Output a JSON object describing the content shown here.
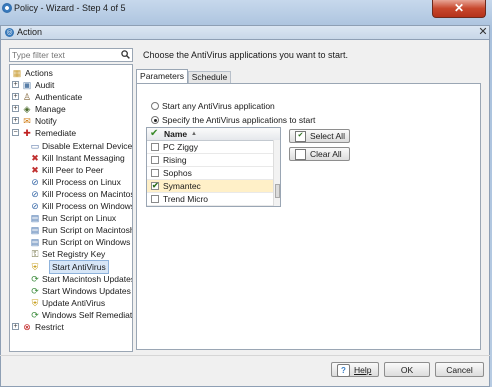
{
  "window": {
    "title": "Policy - Wizard - Step 4 of 5",
    "close_glyph": "✕"
  },
  "dialog": {
    "title": "Action",
    "close_glyph": "✕"
  },
  "filter": {
    "placeholder": "Type filter text"
  },
  "tree": {
    "root": "Actions",
    "items": [
      {
        "label": "Audit",
        "icon": "audit-icon"
      },
      {
        "label": "Authenticate",
        "icon": "authenticate-icon"
      },
      {
        "label": "Manage",
        "icon": "manage-icon"
      },
      {
        "label": "Notify",
        "icon": "notify-icon"
      },
      {
        "label": "Remediate",
        "icon": "remediate-icon"
      },
      {
        "label": "Disable External Device",
        "icon": "device-icon"
      },
      {
        "label": "Kill Instant Messaging",
        "icon": "kill-icon"
      },
      {
        "label": "Kill Peer to Peer",
        "icon": "kill-icon"
      },
      {
        "label": "Kill Process on Linux",
        "icon": "process-icon"
      },
      {
        "label": "Kill Process on Macintosh",
        "icon": "process-icon"
      },
      {
        "label": "Kill Process on Windows",
        "icon": "process-icon"
      },
      {
        "label": "Run Script on Linux",
        "icon": "script-icon"
      },
      {
        "label": "Run Script on Macintosh",
        "icon": "script-icon"
      },
      {
        "label": "Run Script on Windows",
        "icon": "script-icon"
      },
      {
        "label": "Set Registry Key",
        "icon": "registry-icon"
      },
      {
        "label": "Start AntiVirus",
        "icon": "shield-icon"
      },
      {
        "label": "Start Macintosh Updates",
        "icon": "update-icon"
      },
      {
        "label": "Start Windows Updates",
        "icon": "update-icon"
      },
      {
        "label": "Update AntiVirus",
        "icon": "shield-icon"
      },
      {
        "label": "Windows Self Remediation",
        "icon": "update-icon"
      },
      {
        "label": "Restrict",
        "icon": "restrict-icon"
      }
    ]
  },
  "main": {
    "instruction": "Choose the AntiVirus applications you want to start.",
    "tabs": [
      "Parameters",
      "Schedule"
    ],
    "options": [
      "Start any AntiVirus application",
      "Specify the AntiVirus applications to start"
    ],
    "list": {
      "header": "Name",
      "sort_glyph": "▲",
      "rows": [
        {
          "name": "PC Ziggy",
          "checked": false
        },
        {
          "name": "Rising",
          "checked": false
        },
        {
          "name": "Sophos",
          "checked": false
        },
        {
          "name": "Symantec",
          "checked": true
        },
        {
          "name": "Trend Micro",
          "checked": false
        }
      ]
    },
    "select_all": "Select All",
    "clear_all": "Clear All"
  },
  "footer": {
    "help": "Help",
    "ok": "OK",
    "cancel": "Cancel"
  },
  "colors": {
    "accent": "#3b7fc4",
    "selected_row": "#fff0c8",
    "tree_selected": "#d7e6f7"
  }
}
